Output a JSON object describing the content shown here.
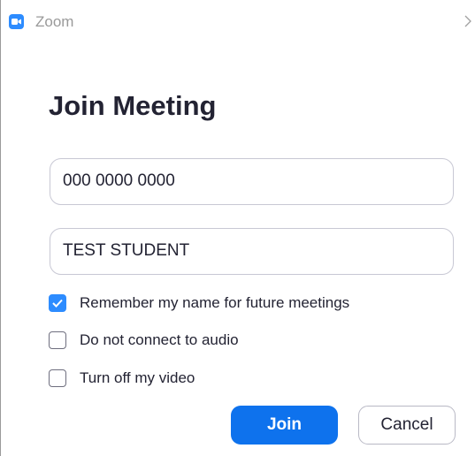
{
  "window": {
    "app_title": "Zoom",
    "app_icon": "zoom-camera-icon",
    "overflow_icon": "chevron-right-icon"
  },
  "dialog": {
    "heading": "Join Meeting",
    "meeting_id_value": "000 0000 0000",
    "name_value": "TEST STUDENT",
    "options": [
      {
        "label": "Remember my name for future meetings",
        "checked": true
      },
      {
        "label": "Do not connect to audio",
        "checked": false
      },
      {
        "label": "Turn off my video",
        "checked": false
      }
    ],
    "join_label": "Join",
    "cancel_label": "Cancel"
  },
  "colors": {
    "accent": "#2d8cff",
    "primary_button": "#0e72ed",
    "heading_text": "#232333",
    "title_text": "#9a9a9a"
  }
}
